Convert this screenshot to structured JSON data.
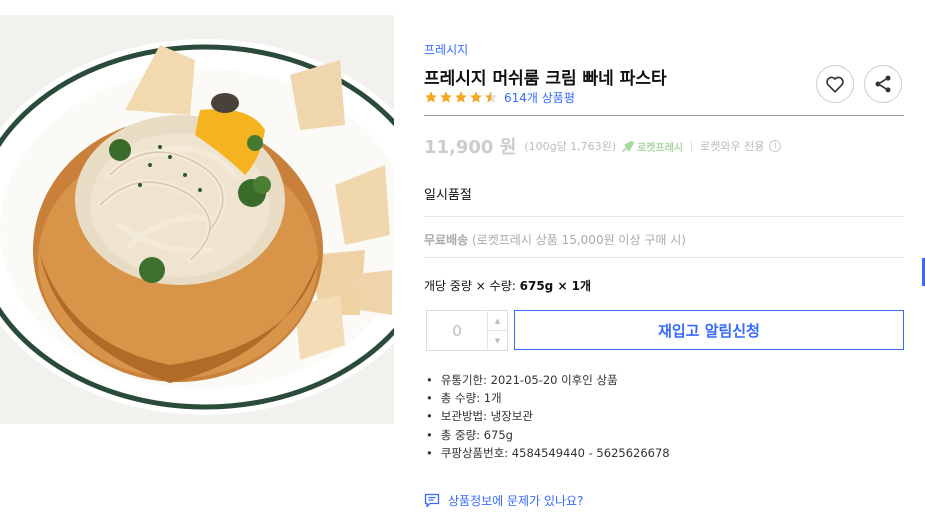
{
  "product": {
    "brand": "프레시지",
    "title": "프레시지 머쉬룸 크림 빠네 파스타",
    "rating": 4.5,
    "review_count": "614개 상품평",
    "price": "11,900 원",
    "unit_price": "(100g당 1,763원)",
    "rocket_fresh": "로켓프레시",
    "rocket_wow": "로켓와우 전용",
    "status": "일시품절",
    "shipping": {
      "label": "무료배송",
      "condition": "(로켓프레시 상품 15,000원 이상 구매 시)"
    },
    "weight_qty": {
      "label": "개당 중량 × 수량:",
      "value": "675g × 1개"
    },
    "quantity": "0",
    "notify_button": "재입고 알림신청",
    "details": [
      "유통기한: 2021-05-20 이후인 상품",
      "총 수량: 1개",
      "보관방법: 냉장보관",
      "총 중량: 675g",
      "쿠팡상품번호: 4584549440 - 5625626678"
    ],
    "report_link": "상품정보에 문제가 있나요?"
  },
  "icons": {
    "wishlist": "heart-icon",
    "share": "share-icon",
    "info": "info-icon",
    "rocket": "rocket-icon",
    "report": "chat-report-icon"
  },
  "colors": {
    "accent": "#346aff",
    "star": "#f5a623",
    "disabled_price": "#cccccc",
    "rocket_fresh": "#a8d8a0"
  }
}
